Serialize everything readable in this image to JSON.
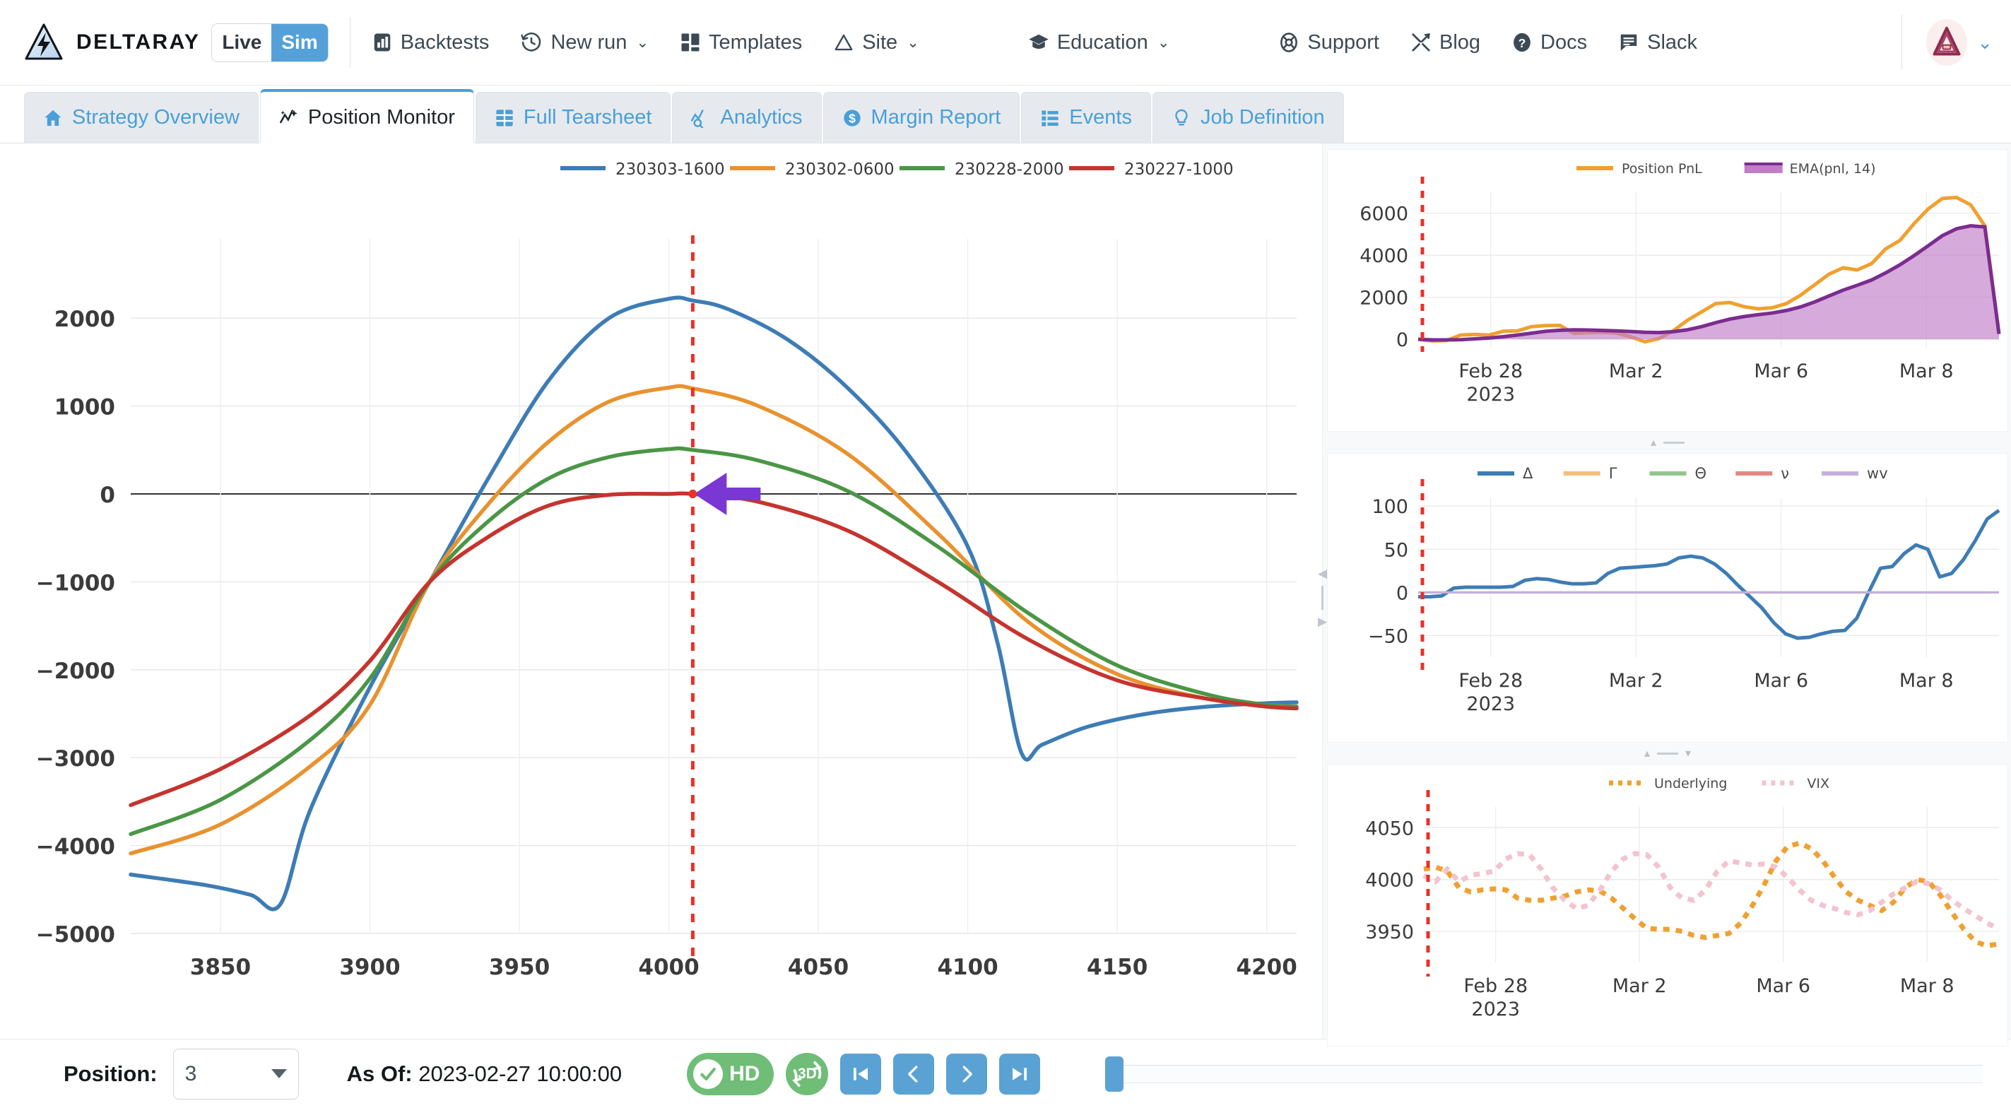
{
  "brand": {
    "name": "DELTARAY",
    "logo_icon": "lightning-triangle-icon",
    "mode_live": "Live",
    "mode_sim": "Sim",
    "mode_active": "Sim"
  },
  "navbar": {
    "items": [
      {
        "label": "Backtests",
        "icon": "bar-chart-icon",
        "caret": false
      },
      {
        "label": "New run",
        "icon": "history-clock-icon",
        "caret": true
      },
      {
        "label": "Templates",
        "icon": "layout-grid-icon",
        "caret": false
      },
      {
        "label": "Site",
        "icon": "triangle-icon",
        "caret": true
      }
    ],
    "items_right": [
      {
        "label": "Education",
        "icon": "graduation-cap-icon",
        "caret": true
      },
      {
        "label": "Support",
        "icon": "lifebuoy-icon",
        "caret": false
      },
      {
        "label": "Blog",
        "icon": "tools-icon",
        "caret": false
      },
      {
        "label": "Docs",
        "icon": "question-circle-icon",
        "caret": false
      },
      {
        "label": "Slack",
        "icon": "chat-bubble-icon",
        "caret": false
      }
    ],
    "avatar_icon": "user-avatar-icon"
  },
  "tabs": [
    {
      "label": "Strategy Overview",
      "icon": "home-icon",
      "active": false
    },
    {
      "label": "Position Monitor",
      "icon": "trend-sparkle-icon",
      "active": true
    },
    {
      "label": "Full Tearsheet",
      "icon": "grid-table-icon",
      "active": false
    },
    {
      "label": "Analytics",
      "icon": "chart-search-icon",
      "active": false
    },
    {
      "label": "Margin Report",
      "icon": "dollar-circle-icon",
      "active": false
    },
    {
      "label": "Events",
      "icon": "list-icon",
      "active": false
    },
    {
      "label": "Job Definition",
      "icon": "lightbulb-icon",
      "active": false
    }
  ],
  "toolbar": {
    "position_label": "Position:",
    "position_value": "3",
    "asof_label": "As Of:",
    "asof_value": "2023-02-27 10:00:00",
    "hd_label": "HD",
    "badge_3d_label": "3D",
    "nav_first_icon": "skip-to-start-icon",
    "nav_prev_icon": "step-back-icon",
    "nav_next_icon": "step-forward-icon",
    "nav_last_icon": "skip-to-end-icon"
  },
  "colors": {
    "accent": "#4a9fd8",
    "series_blue": "#3d7cb5",
    "series_orange": "#e8922f",
    "series_green": "#4a9646",
    "series_red": "#c5342e",
    "purple": "#7b2d8e",
    "purple_fill": "#c07dc7",
    "marker_red": "#e8312a",
    "cursor_purple": "#7a37d4",
    "green_badge": "#6fbd77",
    "vix_pink": "#f3c3ce"
  },
  "chart_data": [
    {
      "id": "payoff-chart",
      "type": "line",
      "title": "",
      "xlabel": "",
      "ylabel": "",
      "xlim": [
        3820,
        4210
      ],
      "ylim": [
        -5000,
        2500
      ],
      "xticks": [
        3850,
        3900,
        3950,
        4000,
        4050,
        4100,
        4150,
        4200
      ],
      "yticks": [
        2000,
        1000,
        0,
        -1000,
        -2000,
        -3000,
        -4000,
        -5000
      ],
      "grid": true,
      "legend_position": "top",
      "cursor_x": 4008,
      "cursor_y": 0,
      "legend": [
        "230303-1600",
        "230302-0600",
        "230228-2000",
        "230227-1000"
      ],
      "series": [
        {
          "name": "230303-1600",
          "color": "#3d7cb5",
          "x": [
            3820,
            3845,
            3860,
            3870,
            3880,
            3900,
            3920,
            3940,
            3960,
            3980,
            4000,
            4008,
            4020,
            4040,
            4060,
            4080,
            4100,
            4110,
            4118,
            4125,
            4140,
            4160,
            4180,
            4200,
            4210
          ],
          "y": [
            -4330,
            -4450,
            -4560,
            -4670,
            -3600,
            -2200,
            -1000,
            200,
            1300,
            2000,
            2220,
            2200,
            2100,
            1750,
            1200,
            450,
            -600,
            -1700,
            -2950,
            -2850,
            -2650,
            -2500,
            -2420,
            -2380,
            -2370
          ]
        },
        {
          "name": "230302-0600",
          "color": "#e8922f",
          "x": [
            3820,
            3850,
            3880,
            3900,
            3920,
            3940,
            3960,
            3980,
            4000,
            4008,
            4030,
            4060,
            4090,
            4120,
            4150,
            4180,
            4200,
            4210
          ],
          "y": [
            -4090,
            -3760,
            -3100,
            -2400,
            -1000,
            -100,
            600,
            1050,
            1210,
            1200,
            1000,
            450,
            -450,
            -1450,
            -2050,
            -2330,
            -2400,
            -2420
          ]
        },
        {
          "name": "230228-2000",
          "color": "#4a9646",
          "x": [
            3820,
            3850,
            3880,
            3900,
            3920,
            3940,
            3960,
            3980,
            4000,
            4008,
            4030,
            4060,
            4090,
            4120,
            4150,
            4180,
            4200,
            4210
          ],
          "y": [
            -3870,
            -3480,
            -2800,
            -2100,
            -1000,
            -300,
            180,
            420,
            510,
            500,
            380,
            30,
            -600,
            -1350,
            -1950,
            -2280,
            -2400,
            -2420
          ]
        },
        {
          "name": "230227-1000",
          "color": "#c5342e",
          "x": [
            3820,
            3850,
            3880,
            3900,
            3920,
            3940,
            3960,
            3980,
            4000,
            4008,
            4030,
            4060,
            4090,
            4120,
            4150,
            4180,
            4200,
            4210
          ],
          "y": [
            -3540,
            -3130,
            -2520,
            -1900,
            -1000,
            -480,
            -130,
            -10,
            0,
            0,
            -90,
            -420,
            -1000,
            -1650,
            -2120,
            -2330,
            -2420,
            -2440
          ]
        }
      ]
    },
    {
      "id": "pnl-chart",
      "type": "area",
      "title": "",
      "xlabel": "",
      "ylabel": "",
      "ylim": [
        -400,
        7000
      ],
      "yticks": [
        0,
        2000,
        4000,
        6000
      ],
      "xticks": [
        "Feb 28\n2023",
        "Mar 2",
        "Mar 6",
        "Mar 8"
      ],
      "grid": true,
      "legend_position": "top",
      "legend": [
        "Position PnL",
        "EMA(pnl, 14)"
      ],
      "marker_x_ratio": 0.02,
      "series": [
        {
          "name": "Position PnL",
          "color": "#f0a030",
          "style": "line",
          "values": [
            0,
            -80,
            -60,
            200,
            230,
            200,
            380,
            400,
            600,
            650,
            660,
            280,
            320,
            330,
            300,
            120,
            -120,
            30,
            400,
            900,
            1300,
            1700,
            1750,
            1550,
            1450,
            1500,
            1700,
            2100,
            2600,
            3100,
            3400,
            3300,
            3600,
            4300,
            4700,
            5500,
            6200,
            6700,
            6750,
            6400,
            5400,
            300
          ]
        },
        {
          "name": "EMA(pnl, 14)",
          "color": "#7b2d8e",
          "fill": "#c07dc7",
          "style": "area",
          "values": [
            0,
            -30,
            -30,
            -20,
            20,
            60,
            120,
            200,
            290,
            380,
            430,
            450,
            440,
            420,
            400,
            370,
            330,
            320,
            360,
            450,
            600,
            790,
            960,
            1080,
            1170,
            1250,
            1370,
            1540,
            1780,
            2060,
            2340,
            2570,
            2820,
            3160,
            3540,
            3980,
            4450,
            4930,
            5260,
            5400,
            5350,
            250
          ]
        }
      ]
    },
    {
      "id": "greeks-chart",
      "type": "line",
      "title": "",
      "ylim": [
        -75,
        110
      ],
      "yticks": [
        100,
        50,
        0,
        -50
      ],
      "xticks": [
        "Feb 28\n2023",
        "Mar 2",
        "Mar 6",
        "Mar 8"
      ],
      "grid": true,
      "legend_position": "top",
      "legend": [
        "Δ",
        "Γ",
        "Θ",
        "ν",
        "wv"
      ],
      "series": [
        {
          "name": "Δ",
          "color": "#3d7cb5",
          "values": [
            -5,
            -5,
            -4,
            5,
            6,
            6,
            6,
            6,
            7,
            14,
            16,
            15,
            12,
            10,
            10,
            11,
            22,
            28,
            29,
            30,
            31,
            33,
            40,
            42,
            40,
            33,
            22,
            8,
            -5,
            -18,
            -35,
            -48,
            -53,
            -52,
            -48,
            -45,
            -44,
            -30,
            0,
            28,
            30,
            45,
            55,
            50,
            18,
            22,
            38,
            60,
            85,
            95
          ]
        },
        {
          "name": "Γ",
          "color": "#f5c07a",
          "values": [
            0,
            0,
            0,
            0,
            0,
            0,
            0,
            0,
            0,
            0,
            0,
            0,
            0,
            0,
            0,
            0,
            0,
            0,
            0,
            0,
            0,
            0,
            0,
            0,
            0,
            0,
            0,
            0,
            0,
            0,
            0,
            0,
            0,
            0,
            0,
            0,
            0,
            0,
            0,
            0,
            0,
            0,
            0,
            0,
            0,
            0,
            0,
            0,
            0,
            0
          ]
        },
        {
          "name": "Θ",
          "color": "#93c68e",
          "values": [
            0,
            0,
            0,
            0,
            0,
            0,
            0,
            0,
            0,
            0,
            0,
            0,
            0,
            0,
            0,
            0,
            0,
            0,
            0,
            0,
            0,
            0,
            0,
            0,
            0,
            0,
            0,
            0,
            0,
            0,
            0,
            0,
            0,
            0,
            0,
            0,
            0,
            0,
            0,
            0,
            0,
            0,
            0,
            0,
            0,
            0,
            0,
            0,
            0,
            0
          ]
        },
        {
          "name": "ν",
          "color": "#e08a82",
          "values": [
            0,
            0,
            0,
            0,
            0,
            0,
            0,
            0,
            0,
            0,
            0,
            0,
            0,
            0,
            0,
            0,
            0,
            0,
            0,
            0,
            0,
            0,
            0,
            0,
            0,
            0,
            0,
            0,
            0,
            0,
            0,
            0,
            0,
            0,
            0,
            0,
            0,
            0,
            0,
            0,
            0,
            0,
            0,
            0,
            0,
            0,
            0,
            0,
            0,
            0
          ]
        },
        {
          "name": "wv",
          "color": "#c3b0dd",
          "values": [
            0,
            0,
            0,
            0,
            0,
            0,
            0,
            0,
            0,
            0,
            0,
            0,
            0,
            0,
            0,
            0,
            0,
            0,
            0,
            0,
            0,
            0,
            0,
            0,
            0,
            0,
            0,
            0,
            0,
            0,
            0,
            0,
            0,
            0,
            0,
            0,
            0,
            0,
            0,
            0,
            0,
            0,
            0,
            0,
            0,
            0,
            0,
            0,
            0,
            0
          ]
        }
      ]
    },
    {
      "id": "underlying-chart",
      "type": "line",
      "title": "",
      "ylim": [
        3920,
        4070
      ],
      "yticks": [
        4050,
        4000,
        3950
      ],
      "xticks": [
        "Feb 28\n2023",
        "Mar 2",
        "Mar 6",
        "Mar 8"
      ],
      "grid": true,
      "legend_position": "top",
      "legend": [
        "Underlying",
        "VIX"
      ],
      "series": [
        {
          "name": "Underlying",
          "color": "#f0a030",
          "style": "dotted",
          "values": [
            4010,
            4012,
            4008,
            3992,
            3988,
            3990,
            3991,
            3990,
            3982,
            3980,
            3980,
            3982,
            3984,
            3988,
            3990,
            3989,
            3982,
            3972,
            3962,
            3953,
            3952,
            3952,
            3950,
            3946,
            3944,
            3946,
            3948,
            3958,
            3975,
            3995,
            4018,
            4032,
            4035,
            4030,
            4018,
            4002,
            3988,
            3980,
            3975,
            3970,
            3978,
            3992,
            4000,
            3998,
            3985,
            3968,
            3952,
            3940,
            3936,
            3938
          ]
        },
        {
          "name": "VIX",
          "color": "#f3c3ce",
          "style": "dotted",
          "values": [
            4004,
            3998,
            4010,
            3998,
            4004,
            4006,
            4008,
            4020,
            4025,
            4024,
            4010,
            3992,
            3980,
            3972,
            3975,
            3990,
            4008,
            4020,
            4025,
            4024,
            4012,
            3992,
            3982,
            3980,
            3990,
            4008,
            4018,
            4016,
            4014,
            4015,
            4012,
            4002,
            3990,
            3980,
            3975,
            3972,
            3968,
            3966,
            3970,
            3978,
            3986,
            3992,
            3998,
            3996,
            3990,
            3980,
            3972,
            3965,
            3958,
            3952
          ]
        }
      ]
    }
  ]
}
